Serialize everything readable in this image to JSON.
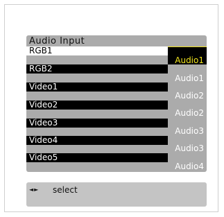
{
  "panel": {
    "title": "Audio Input",
    "rows": [
      {
        "input": "RGB1",
        "audio": "Audio1",
        "selected": true
      },
      {
        "input": "RGB2",
        "audio": "Audio1",
        "selected": false
      },
      {
        "input": "Video1",
        "audio": "Audio2",
        "selected": false
      },
      {
        "input": "Video2",
        "audio": "Audio2",
        "selected": false
      },
      {
        "input": "Video3",
        "audio": "Audio3",
        "selected": false
      },
      {
        "input": "Video4",
        "audio": "Audio3",
        "selected": false
      },
      {
        "input": "Video5",
        "audio": "Audio4",
        "selected": false
      }
    ]
  },
  "footer": {
    "arrows": "◄►",
    "hint": "select"
  },
  "colors": {
    "panel_bg": "#ababab",
    "row_bg": "#000000",
    "selected_bg": "#ffffff",
    "active_audio": "#f0e31e",
    "footer_bg": "#c4c4c4"
  }
}
